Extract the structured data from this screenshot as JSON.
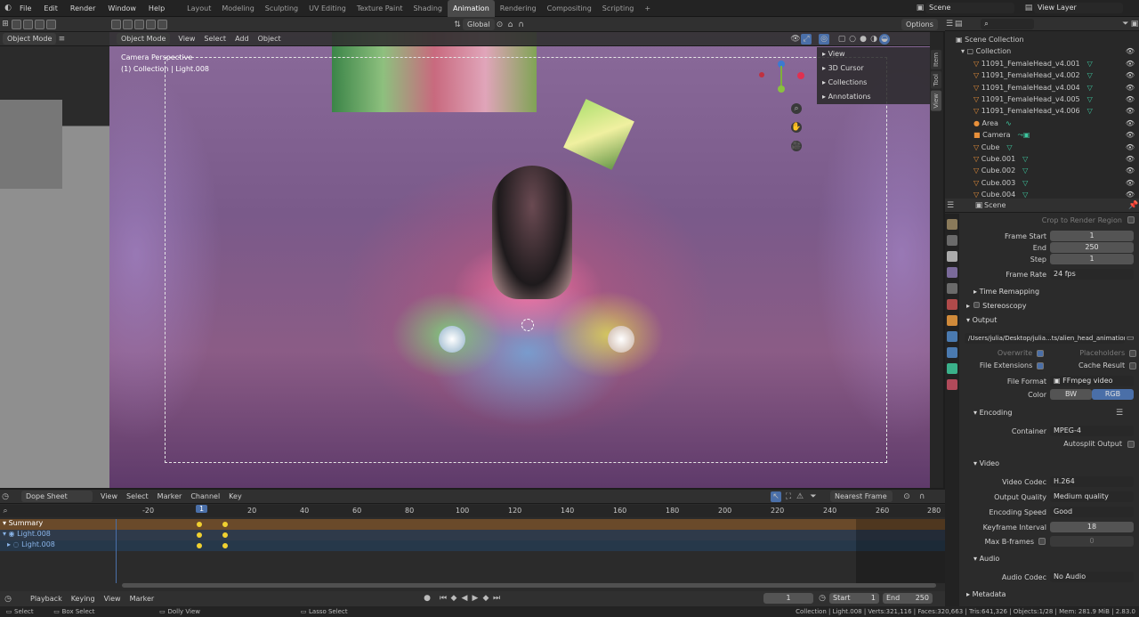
{
  "menu": [
    "File",
    "Edit",
    "Render",
    "Window",
    "Help"
  ],
  "workspaces": [
    "Layout",
    "Modeling",
    "Sculpting",
    "UV Editing",
    "Texture Paint",
    "Shading",
    "Animation",
    "Rendering",
    "Compositing",
    "Scripting"
  ],
  "active_workspace": "Animation",
  "scene": "Scene",
  "view_layer": "View Layer",
  "left_header": {
    "mode": "Object Mode"
  },
  "vp_header": {
    "mode": "Object Mode",
    "menus": [
      "View",
      "Select",
      "Add",
      "Object"
    ],
    "orientation": "Global",
    "options": "Options"
  },
  "viewport": {
    "line1": "Camera Perspective",
    "line2": "(1) Collection | Light.008"
  },
  "nav_panel": [
    "View",
    "3D Cursor",
    "Collections",
    "Annotations"
  ],
  "side_tabs": [
    "Item",
    "Tool",
    "View"
  ],
  "outliner": {
    "root": "Scene Collection",
    "collection": "Collection",
    "items": [
      "11091_FemaleHead_v4.001",
      "11091_FemaleHead_v4.002",
      "11091_FemaleHead_v4.004",
      "11091_FemaleHead_v4.005",
      "11091_FemaleHead_v4.006",
      "Area",
      "Camera",
      "Cube",
      "Cube.001",
      "Cube.002",
      "Cube.003",
      "Cube.004"
    ]
  },
  "props": {
    "title": "Scene",
    "crop": "Crop to Render Region",
    "frame_start_label": "Frame Start",
    "frame_start": "1",
    "end_label": "End",
    "end": "250",
    "step_label": "Step",
    "step": "1",
    "frame_rate_label": "Frame Rate",
    "frame_rate": "24 fps",
    "time_remap": "Time Remapping",
    "stereo": "Stereoscopy",
    "output": "Output",
    "path": "/Users/julia/Desktop/julia...ts/alien_head_animation1",
    "overwrite": "Overwrite",
    "placeholders": "Placeholders",
    "file_ext": "File Extensions",
    "cache": "Cache Result",
    "file_format_label": "File Format",
    "file_format": "FFmpeg video",
    "color_label": "Color",
    "bw": "BW",
    "rgb": "RGB",
    "encoding": "Encoding",
    "container_label": "Container",
    "container": "MPEG-4",
    "autosplit": "Autosplit Output",
    "video": "Video",
    "codec_label": "Video Codec",
    "codec": "H.264",
    "quality_label": "Output Quality",
    "quality": "Medium quality",
    "speed_label": "Encoding Speed",
    "speed": "Good",
    "kf_label": "Keyframe Interval",
    "kf": "18",
    "bframes_label": "Max B-frames",
    "bframes": "0",
    "audio": "Audio",
    "audio_codec_label": "Audio Codec",
    "audio_codec": "No Audio",
    "metadata": "Metadata"
  },
  "dope": {
    "editor": "Dope Sheet",
    "menus": [
      "View",
      "Select",
      "Marker",
      "Channel",
      "Key"
    ],
    "snap": "Nearest Frame",
    "ticks": [
      "-20",
      "20",
      "40",
      "60",
      "80",
      "100",
      "120",
      "140",
      "160",
      "180",
      "200",
      "220",
      "240",
      "260",
      "280"
    ],
    "current": "1",
    "channels": [
      "Summary",
      "Light.008",
      "Light.008"
    ]
  },
  "timeline": {
    "menus": [
      "Playback",
      "Keying",
      "View",
      "Marker"
    ],
    "frame": "1",
    "start_label": "Start",
    "start": "1",
    "end_label": "End",
    "end": "250"
  },
  "status": {
    "select": "Select",
    "box": "Box Select",
    "dolly": "Dolly View",
    "lasso": "Lasso Select",
    "info": "Collection | Light.008 | Verts:321,116 | Faces:320,663 | Tris:641,326 | Objects:1/28 | Mem: 281.9 MiB | 2.83.0"
  }
}
